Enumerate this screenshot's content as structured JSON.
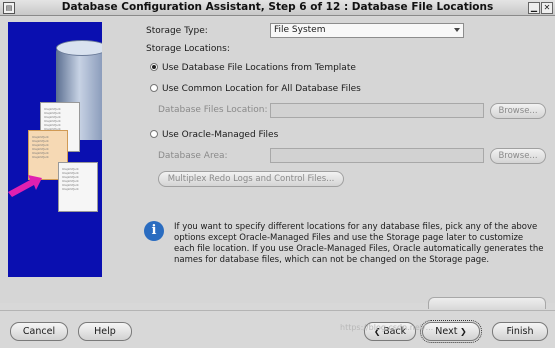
{
  "window": {
    "title": "Database Configuration Assistant, Step 6 of 12 : Database File Locations"
  },
  "illustration": {
    "doc_text": "Ulajzrkfjsdi\nUlajzrkfjsdi\nUlajzrkfjsdi\nUlajzrkfjsdi\nUlajzrkfjsdi\nUlajzrkfjsdi"
  },
  "form": {
    "storage_type_label": "Storage Type:",
    "storage_type_value": "File System",
    "storage_locations_label": "Storage Locations:",
    "radio_template_label": "Use Database File Locations from Template",
    "radio_common_label": "Use Common Location for All Database Files",
    "db_files_location_label": "Database Files Location:",
    "browse1_label": "Browse...",
    "radio_omf_label": "Use Oracle-Managed Files",
    "db_area_label": "Database Area:",
    "browse2_label": "Browse...",
    "multiplex_label": "Multiplex Redo Logs and Control Files..."
  },
  "info": {
    "text": "If you want to specify different locations for any database files, pick any of the above options except Oracle-Managed Files and use the Storage page later to customize each file location. If you use Oracle-Managed Files, Oracle automatically generates the names for database files, which can not be changed on the Storage page."
  },
  "footer": {
    "cancel_label": "Cancel",
    "help_label": "Help",
    "back_label": "Back",
    "next_label": "Next",
    "finish_label": "Finish"
  },
  "watermark": "https://blog.csdn.net/..."
}
